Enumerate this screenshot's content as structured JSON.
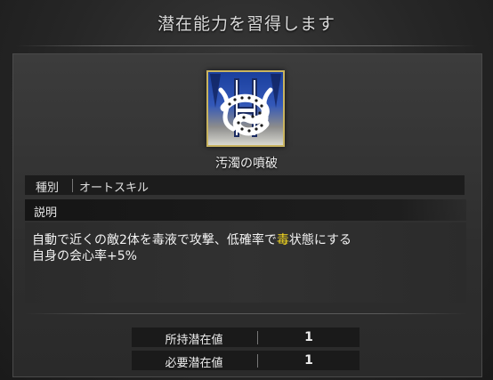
{
  "title": "潜在能力を習得します",
  "skill": {
    "name": "汚濁の噴破",
    "icon": "corrosive-tentacle-emblem-icon",
    "border_color": "#c9b460"
  },
  "type": {
    "label": "種別",
    "value": "オートスキル"
  },
  "description": {
    "header": "説明",
    "line1_before": "自動で近くの敵2体を毒液で攻撃、低確率で",
    "line1_highlight": "毒",
    "line1_after": "状態にする",
    "line2": "自身の会心率+5%",
    "highlight_color": "#f5d820"
  },
  "stats": [
    {
      "label": "所持潜在値",
      "value": "1"
    },
    {
      "label": "必要潜在値",
      "value": "1"
    }
  ]
}
